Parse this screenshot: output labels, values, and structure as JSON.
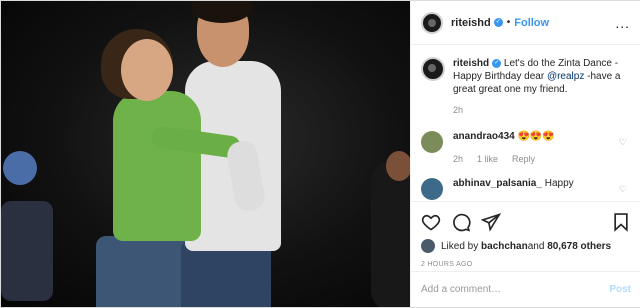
{
  "header": {
    "username": "riteishd",
    "separator": "•",
    "follow_label": "Follow",
    "more_label": "..."
  },
  "caption": {
    "username": "riteishd",
    "text_before": "Let's do the Zinta Dance - Happy Birthday dear ",
    "mention": "@realpz",
    "text_after": " -have a great great one my friend.",
    "time": "2h"
  },
  "comments": [
    {
      "username": "anandrao434",
      "text": "😍😍😍",
      "time": "2h",
      "likes": "1 like",
      "reply_label": "Reply"
    },
    {
      "username": "abhinav_palsania_",
      "text": "Happy"
    }
  ],
  "likes": {
    "prefix": "Liked by ",
    "user": "bachchan",
    "middle": " and ",
    "others": "80,678 others"
  },
  "timestamp": "2 HOURS AGO",
  "add_comment": {
    "placeholder": "Add a comment…",
    "post_label": "Post"
  },
  "colors": {
    "accent": "#3897f0",
    "post_disabled": "#b3dbff",
    "muted": "#8e8e8e"
  }
}
